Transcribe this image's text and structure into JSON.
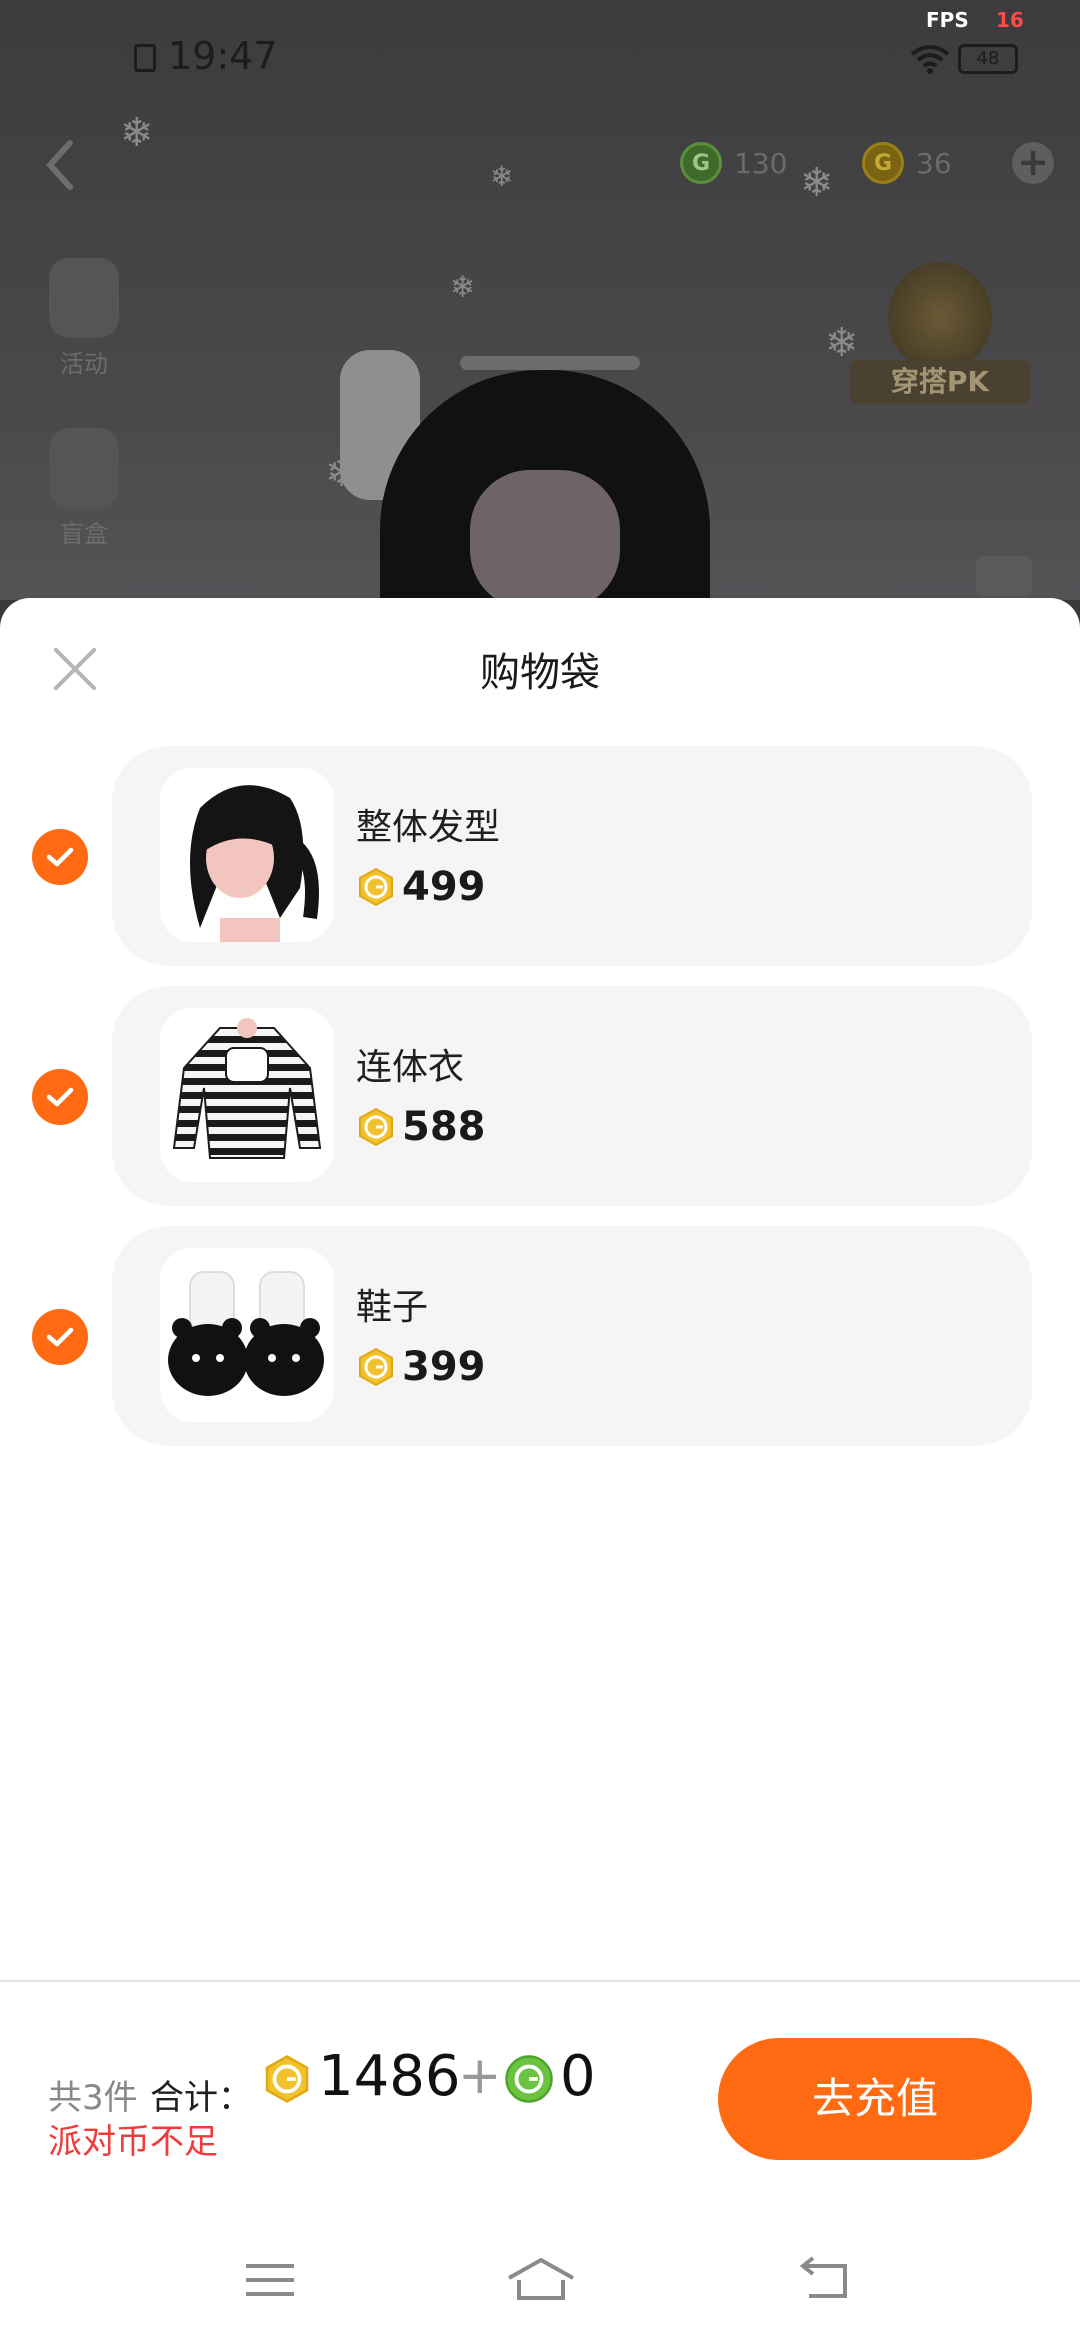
{
  "status": {
    "time": "19:47",
    "fps_label": "FPS",
    "fps_value": "16",
    "battery": "48"
  },
  "header": {
    "green_currency": "130",
    "gold_currency": "36"
  },
  "side_menu": {
    "activity": "活动",
    "blind_box": "盲盒"
  },
  "pk_badge": "穿搭PK",
  "sheet": {
    "title": "购物袋",
    "items": [
      {
        "name": "整体发型",
        "price": "499"
      },
      {
        "name": "连体衣",
        "price": "588"
      },
      {
        "name": "鞋子",
        "price": "399"
      }
    ]
  },
  "footer": {
    "count": "共3件",
    "total_label": "合计：",
    "gold_total": "1486",
    "plus": "+",
    "green_total": "0",
    "warning": "派对币不足",
    "recharge_label": "去充值"
  },
  "colors": {
    "accent": "#ff6a12",
    "warning": "#ef3b3b",
    "coin_gold": "#f2c12e",
    "coin_green": "#6cc341"
  }
}
